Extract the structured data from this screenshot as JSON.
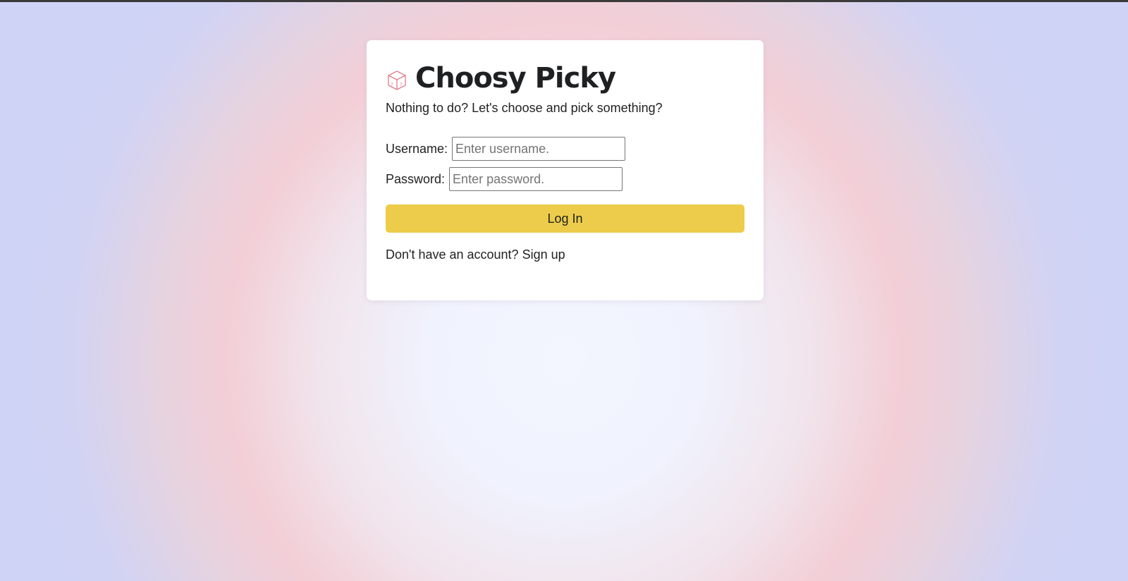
{
  "app": {
    "title": "Choosy Picky",
    "tagline": "Nothing to do? Let's choose and pick something?",
    "logo_icon": "dice-icon"
  },
  "form": {
    "username_label": "Username:",
    "username_placeholder": "Enter username.",
    "username_value": "",
    "password_label": "Password:",
    "password_placeholder": "Enter password.",
    "password_value": "",
    "login_label": "Log In"
  },
  "signup": {
    "prompt": "Don't have an account?",
    "link_label": "Sign up"
  },
  "colors": {
    "button": "#eccc4a",
    "card": "#ffffff",
    "logo_stroke": "#e07b8a"
  }
}
